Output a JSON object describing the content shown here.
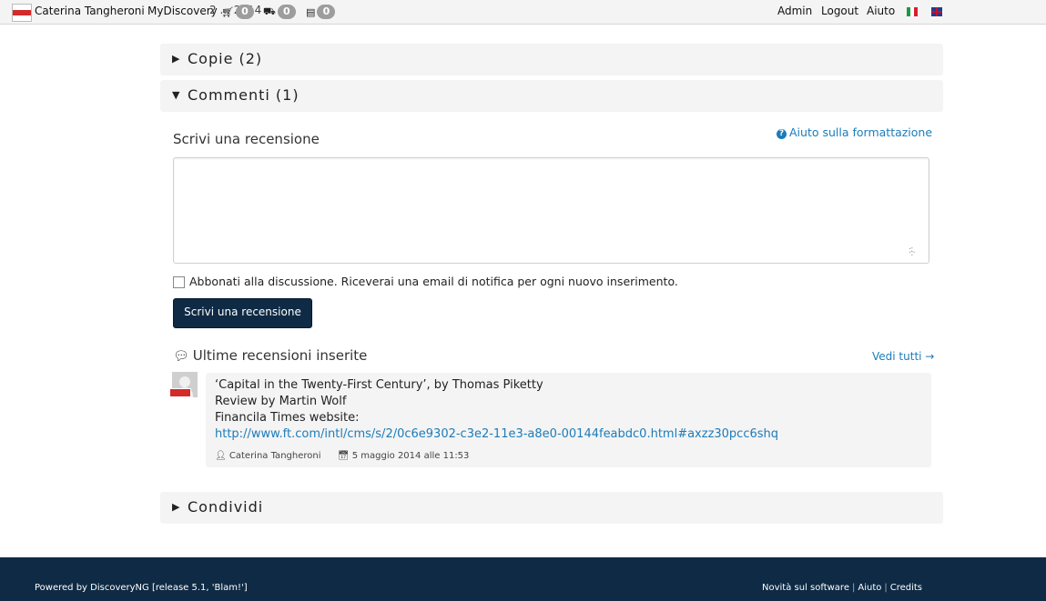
{
  "navbar": {
    "user_name": "Caterina Tangheroni",
    "mydiscovery": "MyDiscovery",
    "hidden_title": "2 ... 2014",
    "cart_count": "0",
    "truck_count": "0",
    "book_count": "0",
    "admin": "Admin",
    "logout": "Logout",
    "help": "Aiuto",
    "flags": [
      "IT",
      "EN"
    ]
  },
  "panels": {
    "copies_title": "Copie (2)",
    "comments_title": "Commenti (1)",
    "share_title": "Condividi"
  },
  "review_form": {
    "title": "Scrivi una recensione",
    "formatting_help": "Aiuto sulla formattazione",
    "textarea_value": "",
    "subscribe_label": "Abbonati alla discussione. Riceverai una email di notifica per ogni nuovo inserimento.",
    "subscribe_checked": false,
    "submit_label": "Scrivi una recensione"
  },
  "latest_reviews": {
    "title": "Ultime recensioni inserite",
    "see_all": "Vedi tutti →",
    "items": [
      {
        "line1": "‘Capital in the Twenty-First Century’, by Thomas Piketty",
        "line2": "Review by Martin Wolf",
        "line3": "Financila Times website:",
        "link": "http://www.ft.com/intl/cms/s/2/0c6e9302-c3e2-11e3-a8e0-00144feabdc0.html#axzz30pcc6shq",
        "author": "Caterina Tangheroni",
        "date": "5 maggio 2014 alle 11:53"
      }
    ]
  },
  "footer": {
    "powered_by": "Powered by DiscoveryNG [release 5.1, 'Blam!']",
    "news": "Novità sul software",
    "help": "Aiuto",
    "credits": "Credits"
  },
  "colors": {
    "primary_dark": "#0e2a44",
    "link": "#1c7cba",
    "panel_bg": "#f4f4f4",
    "badge": "#9d9d9d"
  }
}
